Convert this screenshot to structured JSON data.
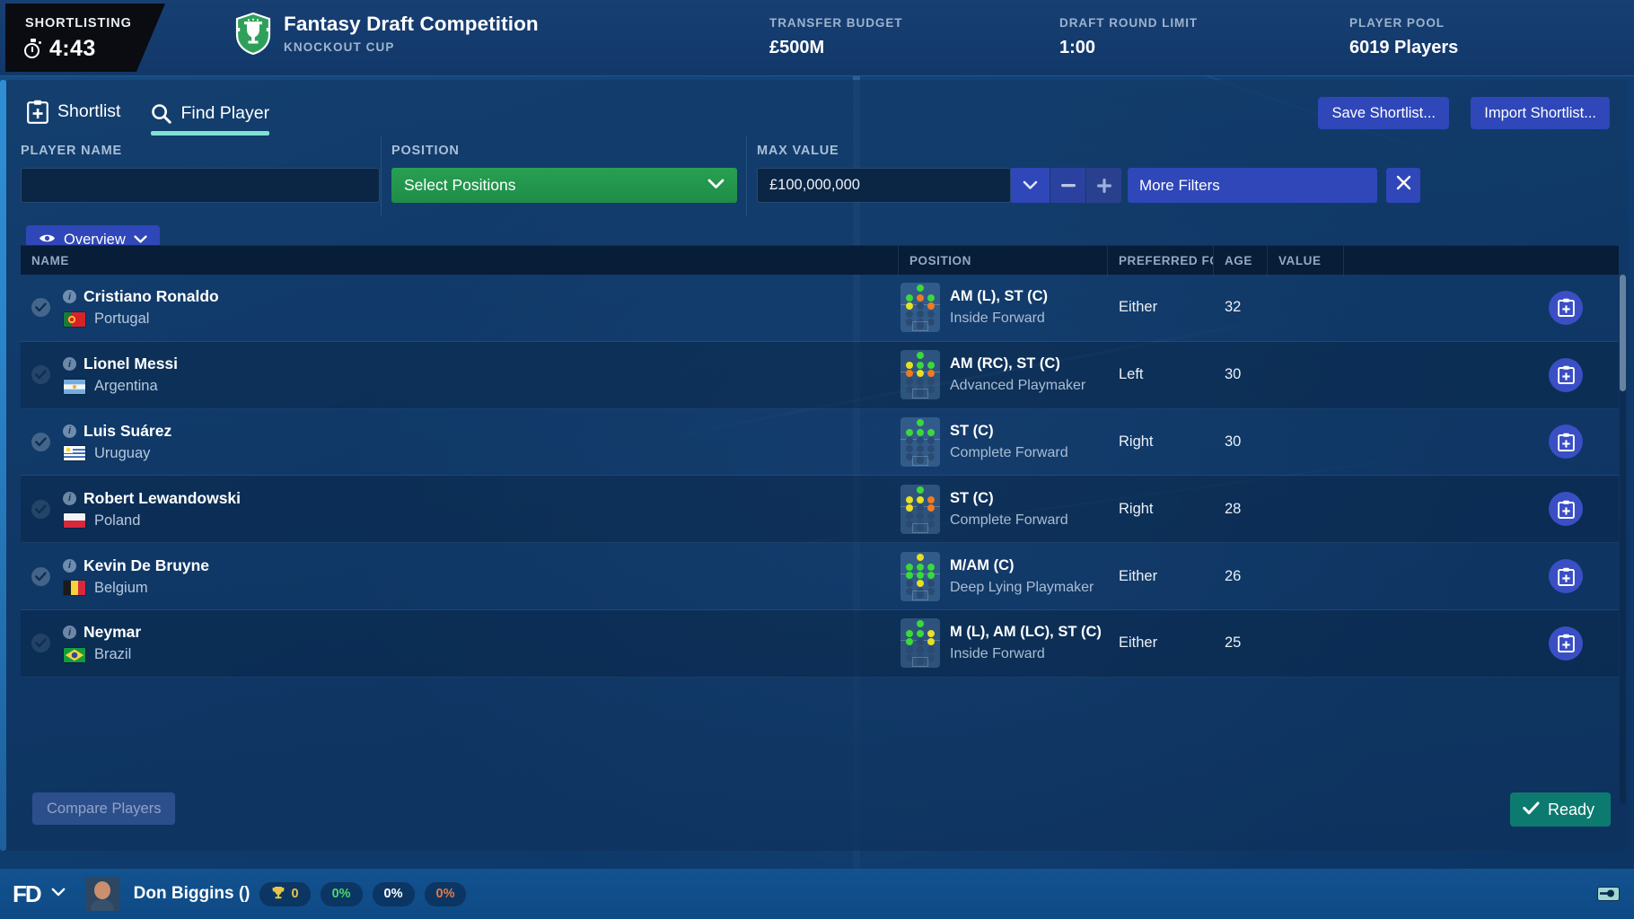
{
  "header": {
    "timer_label": "SHORTLISTING",
    "timer_value": "4:43",
    "timer_icon": "stopwatch-icon",
    "competition_title": "Fantasy Draft Competition",
    "competition_subtitle": "KNOCKOUT CUP",
    "competition_icon": "trophy-shield-icon",
    "stats": [
      {
        "label": "TRANSFER BUDGET",
        "value": "£500M"
      },
      {
        "label": "DRAFT ROUND LIMIT",
        "value": "1:00"
      },
      {
        "label": "PLAYER POOL",
        "value": "6019 Players"
      }
    ]
  },
  "tabs": [
    {
      "label": "Shortlist",
      "icon": "clipboard-plus-icon",
      "active": false
    },
    {
      "label": "Find Player",
      "icon": "search-icon",
      "active": true
    }
  ],
  "toolbar": {
    "save_label": "Save Shortlist...",
    "import_label": "Import Shortlist..."
  },
  "filters": {
    "name_label": "PLAYER NAME",
    "name_value": "",
    "name_placeholder": "",
    "position_label": "POSITION",
    "position_value": "Select Positions",
    "max_value_label": "MAX VALUE",
    "max_value": "£100,000,000",
    "more_filters_label": "More Filters",
    "clear_icon": "close-icon",
    "dropdown_icon": "chevron-down-icon",
    "minus_icon": "minus-icon",
    "plus_icon": "plus-icon"
  },
  "view": {
    "label": "Overview",
    "icon": "eye-icon",
    "chevron": "chevron-down-icon"
  },
  "table": {
    "columns": [
      "NAME",
      "POSITION",
      "PREFERRED FO...",
      "AGE",
      "VALUE",
      ""
    ],
    "rows": [
      {
        "name": "Cristiano Ronaldo",
        "nationality": "Portugal",
        "flag": "portugal-flag",
        "position": "AM (L), ST (C)",
        "role": "Inside Forward",
        "foot": "Either",
        "age": "32",
        "value": "",
        "checked": true,
        "pitch_dots": [
          {
            "r": 0,
            "c": 1,
            "color": "g"
          },
          {
            "r": 1,
            "c": 0,
            "color": "g"
          },
          {
            "r": 1,
            "c": 1,
            "color": "o"
          },
          {
            "r": 1,
            "c": 2,
            "color": "g"
          },
          {
            "r": 2,
            "c": 0,
            "color": "y"
          },
          {
            "r": 2,
            "c": 2,
            "color": "o"
          }
        ]
      },
      {
        "name": "Lionel Messi",
        "nationality": "Argentina",
        "flag": "argentina-flag",
        "position": "AM (RC), ST (C)",
        "role": "Advanced Playmaker",
        "foot": "Left",
        "age": "30",
        "value": "",
        "checked": true,
        "pitch_dots": [
          {
            "r": 0,
            "c": 1,
            "color": "g"
          },
          {
            "r": 1,
            "c": 0,
            "color": "y"
          },
          {
            "r": 1,
            "c": 1,
            "color": "g"
          },
          {
            "r": 1,
            "c": 2,
            "color": "g"
          },
          {
            "r": 2,
            "c": 0,
            "color": "o"
          },
          {
            "r": 2,
            "c": 1,
            "color": "y"
          },
          {
            "r": 2,
            "c": 2,
            "color": "o"
          }
        ]
      },
      {
        "name": "Luis Suárez",
        "nationality": "Uruguay",
        "flag": "uruguay-flag",
        "position": "ST (C)",
        "role": "Complete Forward",
        "foot": "Right",
        "age": "30",
        "value": "",
        "checked": true,
        "pitch_dots": [
          {
            "r": 0,
            "c": 1,
            "color": "g"
          },
          {
            "r": 1,
            "c": 0,
            "color": "g"
          },
          {
            "r": 1,
            "c": 1,
            "color": "g"
          },
          {
            "r": 1,
            "c": 2,
            "color": "g"
          }
        ]
      },
      {
        "name": "Robert Lewandowski",
        "nationality": "Poland",
        "flag": "poland-flag",
        "position": "ST (C)",
        "role": "Complete Forward",
        "foot": "Right",
        "age": "28",
        "value": "",
        "checked": true,
        "pitch_dots": [
          {
            "r": 0,
            "c": 1,
            "color": "g"
          },
          {
            "r": 1,
            "c": 0,
            "color": "y"
          },
          {
            "r": 1,
            "c": 1,
            "color": "y"
          },
          {
            "r": 1,
            "c": 2,
            "color": "o"
          },
          {
            "r": 2,
            "c": 0,
            "color": "y"
          },
          {
            "r": 2,
            "c": 2,
            "color": "o"
          }
        ]
      },
      {
        "name": "Kevin De Bruyne",
        "nationality": "Belgium",
        "flag": "belgium-flag",
        "position": "M/AM (C)",
        "role": "Deep Lying Playmaker",
        "foot": "Either",
        "age": "26",
        "value": "",
        "checked": true,
        "pitch_dots": [
          {
            "r": 0,
            "c": 1,
            "color": "y"
          },
          {
            "r": 1,
            "c": 0,
            "color": "g"
          },
          {
            "r": 1,
            "c": 1,
            "color": "g"
          },
          {
            "r": 1,
            "c": 2,
            "color": "g"
          },
          {
            "r": 2,
            "c": 0,
            "color": "g"
          },
          {
            "r": 2,
            "c": 1,
            "color": "g"
          },
          {
            "r": 2,
            "c": 2,
            "color": "g"
          },
          {
            "r": 3,
            "c": 1,
            "color": "y"
          }
        ]
      },
      {
        "name": "Neymar",
        "nationality": "Brazil",
        "flag": "brazil-flag",
        "position": "M (L), AM (LC), ST (C)",
        "role": "Inside Forward",
        "foot": "Either",
        "age": "25",
        "value": "",
        "checked": true,
        "pitch_dots": [
          {
            "r": 0,
            "c": 1,
            "color": "g"
          },
          {
            "r": 1,
            "c": 0,
            "color": "g"
          },
          {
            "r": 1,
            "c": 1,
            "color": "g"
          },
          {
            "r": 1,
            "c": 2,
            "color": "y"
          },
          {
            "r": 2,
            "c": 0,
            "color": "g"
          },
          {
            "r": 2,
            "c": 2,
            "color": "y"
          }
        ]
      }
    ],
    "row_action_icon": "add-to-shortlist-icon"
  },
  "footer_actions": {
    "compare_label": "Compare Players",
    "ready_label": "Ready",
    "ready_icon": "check-icon"
  },
  "statusbar": {
    "logo": "FD",
    "logo_chevron": "chevron-down-icon",
    "user_name": "Don Biggins ()",
    "trophy_icon": "trophy-icon",
    "trophy_count": "0",
    "pct1": "0%",
    "pct2": "0%",
    "pct3": "0%",
    "message_icon": "message-icon"
  },
  "colors": {
    "accent_blue": "#2f47b8",
    "tab_underline": "#7fe3d4",
    "position_green": "#1f8d47",
    "ready_green": "#0d7a70"
  }
}
